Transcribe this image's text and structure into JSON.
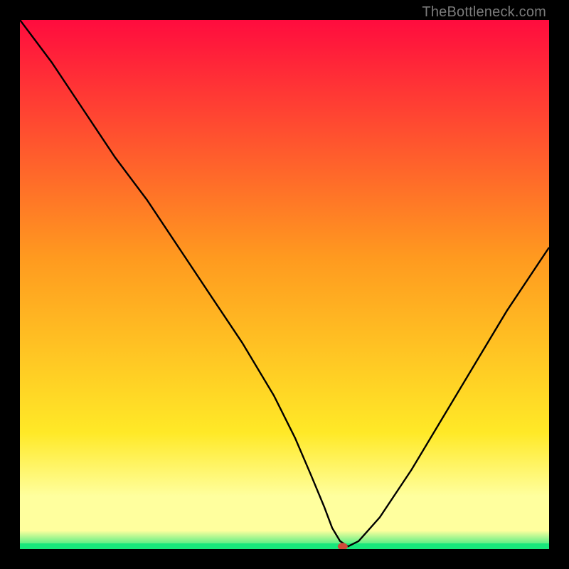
{
  "watermark": "TheBottleneck.com",
  "colors": {
    "top": "#ff0c3e",
    "mid1": "#ff9a1f",
    "mid2": "#ffe927",
    "band": "#ffff9e",
    "green": "#17e87b",
    "marker": "#d04a3a",
    "line": "#000000",
    "frame": "#000000"
  },
  "chart_data": {
    "type": "line",
    "title": "",
    "xlabel": "",
    "ylabel": "",
    "xlim": [
      0,
      100
    ],
    "ylim": [
      0,
      100
    ],
    "x": [
      0,
      6,
      12,
      18,
      24,
      30,
      36,
      42,
      48,
      52,
      55,
      57.5,
      59,
      60.5,
      62,
      64,
      68,
      74,
      80,
      86,
      92,
      98,
      100
    ],
    "y": [
      100,
      92,
      83,
      74,
      66,
      57,
      48,
      39,
      29,
      21,
      14,
      8,
      4,
      1.5,
      0.5,
      1.5,
      6,
      15,
      25,
      35,
      45,
      54,
      57
    ],
    "flat_segment": {
      "x0": 57.5,
      "x1": 62,
      "y": 0.5
    },
    "marker": {
      "x": 61,
      "y": 0.5,
      "rx": 7,
      "ry": 5
    }
  }
}
